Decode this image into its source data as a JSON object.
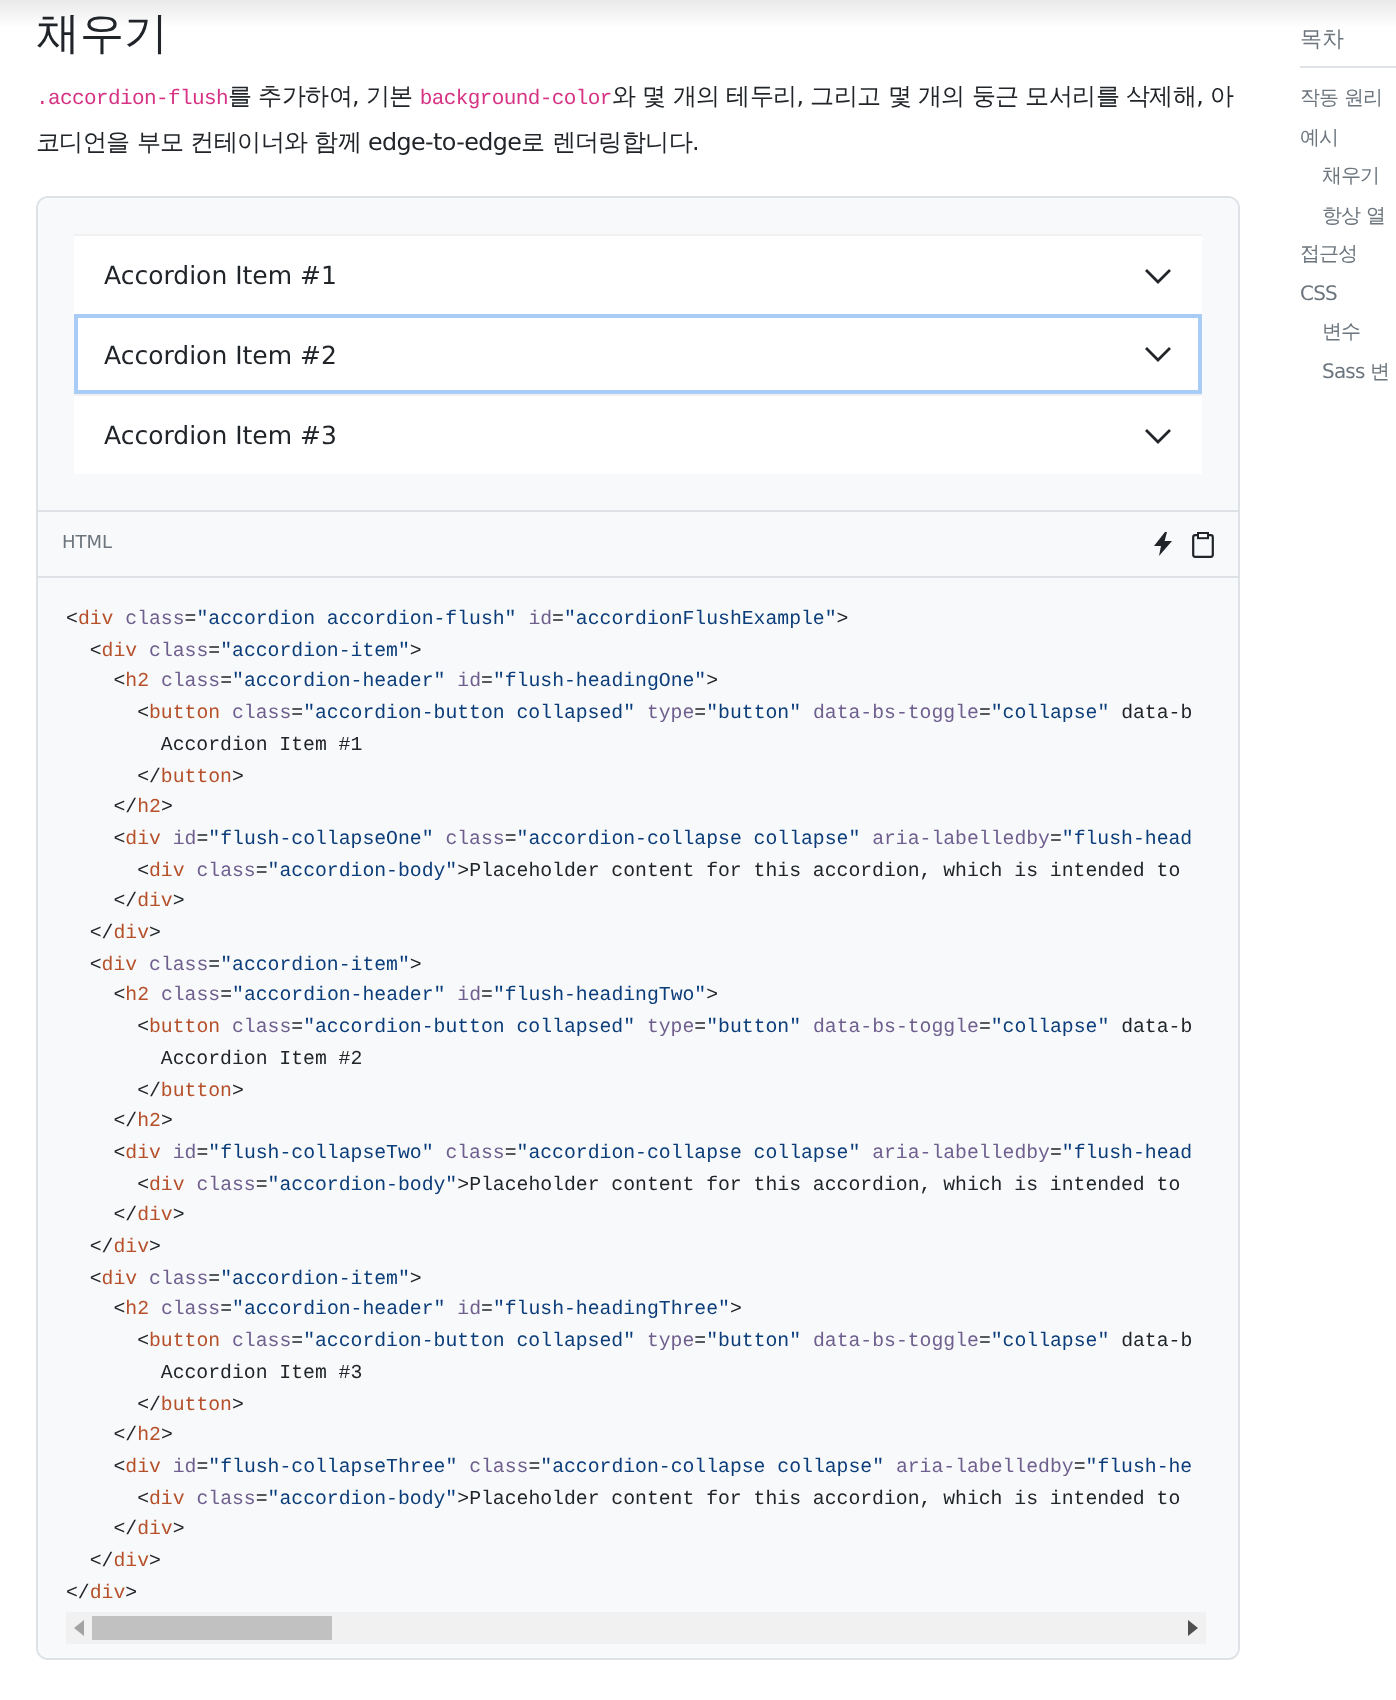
{
  "heading": "채우기",
  "description": [
    {
      "kind": "code",
      "text": ".accordion-flush"
    },
    {
      "kind": "text",
      "text": "를 추가하여, 기본 "
    },
    {
      "kind": "code",
      "text": "background-color"
    },
    {
      "kind": "text",
      "text": "와 몇 개의 테두리, 그리고 몇 개의 둥근 모서리를 삭제해, 아코디언을 부모 컨테이너와 함께 edge-to-edge로 렌더링합니다."
    }
  ],
  "accordion": [
    {
      "label": "Accordion Item #1",
      "focused": false
    },
    {
      "label": "Accordion Item #2",
      "focused": true
    },
    {
      "label": "Accordion Item #3",
      "focused": false
    }
  ],
  "code_header": {
    "language": "HTML"
  },
  "code_lines": [
    "<div class=\"accordion accordion-flush\" id=\"accordionFlushExample\">",
    "  <div class=\"accordion-item\">",
    "    <h2 class=\"accordion-header\" id=\"flush-headingOne\">",
    "      <button class=\"accordion-button collapsed\" type=\"button\" data-bs-toggle=\"collapse\" data-b",
    "        Accordion Item #1",
    "      </button>",
    "    </h2>",
    "    <div id=\"flush-collapseOne\" class=\"accordion-collapse collapse\" aria-labelledby=\"flush-head",
    "      <div class=\"accordion-body\">Placeholder content for this accordion, which is intended to",
    "    </div>",
    "  </div>",
    "  <div class=\"accordion-item\">",
    "    <h2 class=\"accordion-header\" id=\"flush-headingTwo\">",
    "      <button class=\"accordion-button collapsed\" type=\"button\" data-bs-toggle=\"collapse\" data-b",
    "        Accordion Item #2",
    "      </button>",
    "    </h2>",
    "    <div id=\"flush-collapseTwo\" class=\"accordion-collapse collapse\" aria-labelledby=\"flush-head",
    "      <div class=\"accordion-body\">Placeholder content for this accordion, which is intended to",
    "    </div>",
    "  </div>",
    "  <div class=\"accordion-item\">",
    "    <h2 class=\"accordion-header\" id=\"flush-headingThree\">",
    "      <button class=\"accordion-button collapsed\" type=\"button\" data-bs-toggle=\"collapse\" data-b",
    "        Accordion Item #3",
    "      </button>",
    "    </h2>",
    "    <div id=\"flush-collapseThree\" class=\"accordion-collapse collapse\" aria-labelledby=\"flush-he",
    "      <div class=\"accordion-body\">Placeholder content for this accordion, which is intended to",
    "    </div>",
    "  </div>",
    "</div>"
  ],
  "toc": {
    "title": "목차",
    "items": [
      {
        "label": "작동 원리"
      },
      {
        "label": "예시",
        "children": [
          {
            "label": "채우기"
          },
          {
            "label": "항상 열"
          }
        ]
      },
      {
        "label": "접근성"
      },
      {
        "label": "CSS",
        "children": [
          {
            "label": "변수"
          },
          {
            "label": "Sass 변"
          }
        ]
      }
    ]
  }
}
